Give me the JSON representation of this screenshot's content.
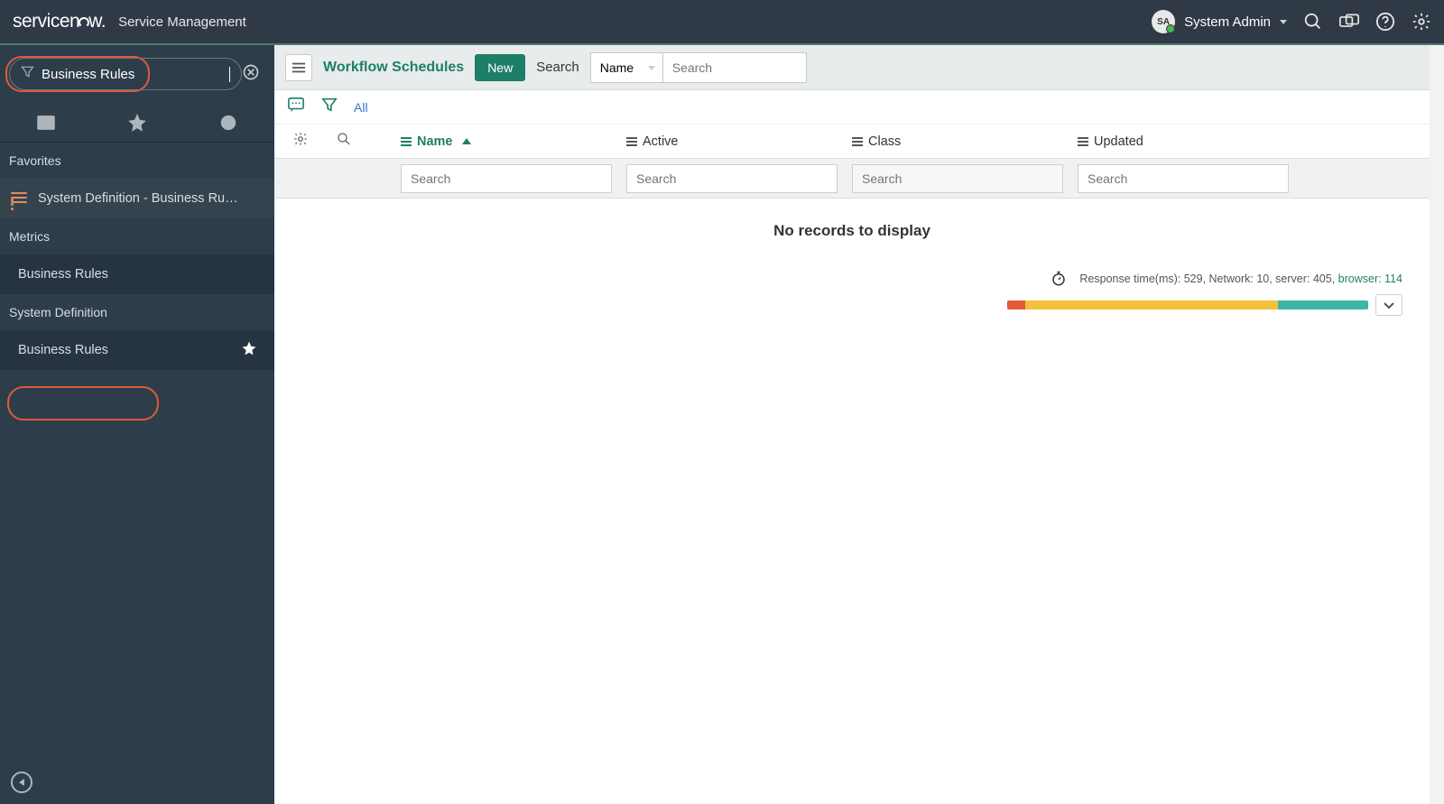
{
  "banner": {
    "brand_a": "service",
    "brand_b": "w.",
    "subtitle": "Service Management",
    "user_initials": "SA",
    "user_name": "System Admin"
  },
  "sidebar": {
    "filter_value": "Business Rules",
    "favorites_header": "Favorites",
    "favorite_item": "System Definition - Business Ru…",
    "section_metrics": "Metrics",
    "item_metrics_br": "Business Rules",
    "section_sysdef": "System Definition",
    "item_sysdef_br": "Business Rules"
  },
  "toolbar": {
    "page_title": "Workflow Schedules",
    "new_label": "New",
    "search_label": "Search",
    "search_field_select": "Name",
    "search_placeholder": "Search"
  },
  "crumbs": {
    "all": "All"
  },
  "columns": {
    "name": "Name",
    "active": "Active",
    "class": "Class",
    "updated": "Updated",
    "search_ph": "Search"
  },
  "body": {
    "no_records": "No records to display"
  },
  "perf": {
    "text_prefix": "Response time(ms): 529, Network: 10, server: 405, ",
    "browser_label": "browser: 114",
    "bar_red_pct": 5,
    "bar_yellow_pct": 70,
    "bar_teal_pct": 25
  }
}
